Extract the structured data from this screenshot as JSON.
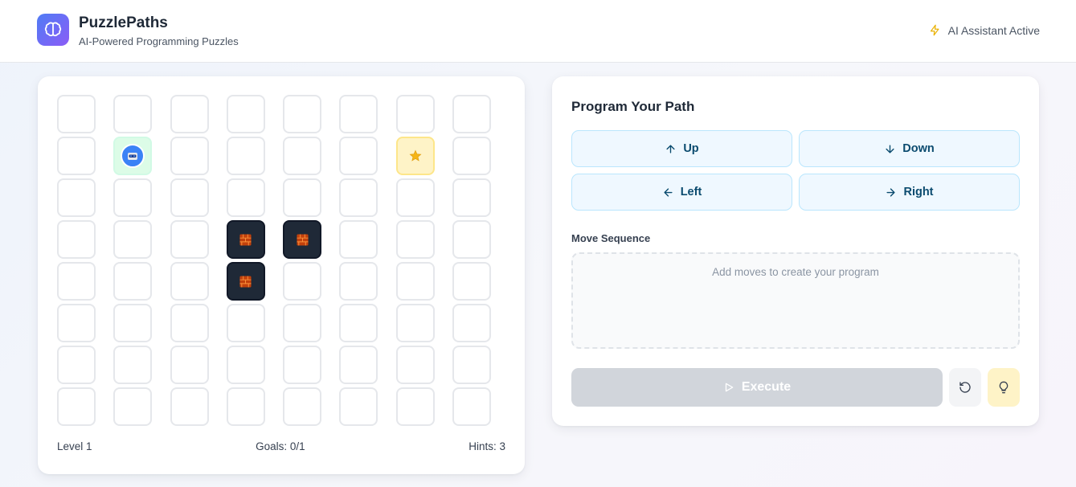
{
  "app": {
    "title": "PuzzlePaths",
    "subtitle": "AI-Powered Programming Puzzles",
    "ai_status": "AI Assistant Active",
    "logo_icon": "brain-icon"
  },
  "board": {
    "rows": 8,
    "cols": 8,
    "player": [
      1,
      1
    ],
    "goal": [
      1,
      6
    ],
    "walls": [
      [
        3,
        3
      ],
      [
        3,
        4
      ],
      [
        4,
        3
      ]
    ],
    "footer": {
      "level": "Level 1",
      "goals": "Goals: 0/1",
      "hints": "Hints: 3"
    }
  },
  "program": {
    "title": "Program Your Path",
    "moves": [
      {
        "label": "Up",
        "icon": "arrow-up-icon"
      },
      {
        "label": "Down",
        "icon": "arrow-down-icon"
      },
      {
        "label": "Left",
        "icon": "arrow-left-icon"
      },
      {
        "label": "Right",
        "icon": "arrow-right-icon"
      }
    ],
    "sequence_label": "Move Sequence",
    "sequence_placeholder": "Add moves to create your program",
    "execute_label": "Execute"
  },
  "colors": {
    "accent": "#0b4b6f",
    "player_cell": "#dcfce7",
    "goal_cell": "#fef3c7",
    "wall_cell": "#1f2937",
    "execute_disabled": "#d1d5db"
  }
}
